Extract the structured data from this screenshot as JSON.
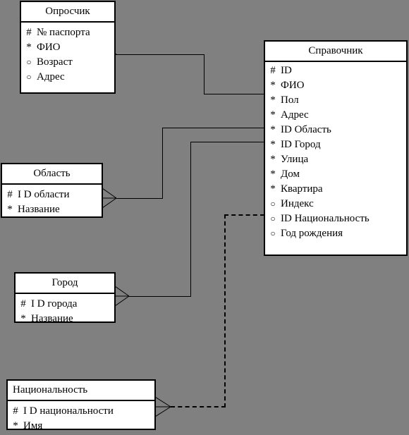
{
  "diagram": {
    "title": "ER diagram",
    "background_color": "#808080",
    "entity_fill": "#ffffff",
    "line_color": "#000000",
    "markers": {
      "primary_key": "#",
      "mandatory": "*",
      "optional": "○"
    }
  },
  "entities": [
    {
      "name": "oproschik",
      "title": "Опросчик",
      "title_align": "center",
      "attributes": [
        {
          "marker": "#",
          "marker_type": "primary_key",
          "label": "№ паспорта"
        },
        {
          "marker": "*",
          "marker_type": "mandatory",
          "label": "ФИО"
        },
        {
          "marker": "○",
          "marker_type": "optional",
          "label": "Возраст"
        },
        {
          "marker": "○",
          "marker_type": "optional",
          "label": "Адрес"
        }
      ]
    },
    {
      "name": "spravochnik",
      "title": "Справочник",
      "title_align": "center",
      "attributes": [
        {
          "marker": "#",
          "marker_type": "primary_key",
          "label": "ID"
        },
        {
          "marker": "*",
          "marker_type": "mandatory",
          "label": "ФИО"
        },
        {
          "marker": "*",
          "marker_type": "mandatory",
          "label": "Пол"
        },
        {
          "marker": "*",
          "marker_type": "mandatory",
          "label": "Адрес"
        },
        {
          "marker": "*",
          "marker_type": "mandatory",
          "label": "ID Область"
        },
        {
          "marker": "*",
          "marker_type": "mandatory",
          "label": "ID Город"
        },
        {
          "marker": "*",
          "marker_type": "mandatory",
          "label": "Улица"
        },
        {
          "marker": "*",
          "marker_type": "mandatory",
          "label": "Дом"
        },
        {
          "marker": "*",
          "marker_type": "mandatory",
          "label": "Квартира"
        },
        {
          "marker": "○",
          "marker_type": "optional",
          "label": "Индекс"
        },
        {
          "marker": "○",
          "marker_type": "optional",
          "label": "ID Национальность"
        },
        {
          "marker": "○",
          "marker_type": "optional",
          "label": "Год рождения"
        }
      ]
    },
    {
      "name": "oblast",
      "title": "Область",
      "title_align": "center",
      "attributes": [
        {
          "marker": "#",
          "marker_type": "primary_key",
          "label": "I D области"
        },
        {
          "marker": "*",
          "marker_type": "mandatory",
          "label": "Название"
        }
      ]
    },
    {
      "name": "gorod",
      "title": "Город",
      "title_align": "center",
      "attributes": [
        {
          "marker": "#",
          "marker_type": "primary_key",
          "label": "I D города"
        },
        {
          "marker": "*",
          "marker_type": "mandatory",
          "label": "Название"
        }
      ]
    },
    {
      "name": "natsionalnost",
      "title": "Национальность",
      "title_align": "left",
      "attributes": [
        {
          "marker": "#",
          "marker_type": "primary_key",
          "label": "I D национальности"
        },
        {
          "marker": "*",
          "marker_type": "mandatory",
          "label": "Имя"
        }
      ]
    }
  ],
  "relationships": [
    {
      "name": "oproschik-to-spravochnik",
      "from": "oproschik",
      "to": "spravochnik",
      "style": "solid",
      "end": "crow-foot"
    },
    {
      "name": "oblast-to-spravochnik",
      "from": "oblast",
      "to": "spravochnik",
      "style": "solid",
      "end": "crow-foot"
    },
    {
      "name": "gorod-to-spravochnik",
      "from": "gorod",
      "to": "spravochnik",
      "style": "solid",
      "end": "crow-foot"
    },
    {
      "name": "natsionalnost-to-spravochnik",
      "from": "natsionalnost",
      "to": "spravochnik",
      "style": "dashed",
      "end": "crow-foot"
    }
  ]
}
